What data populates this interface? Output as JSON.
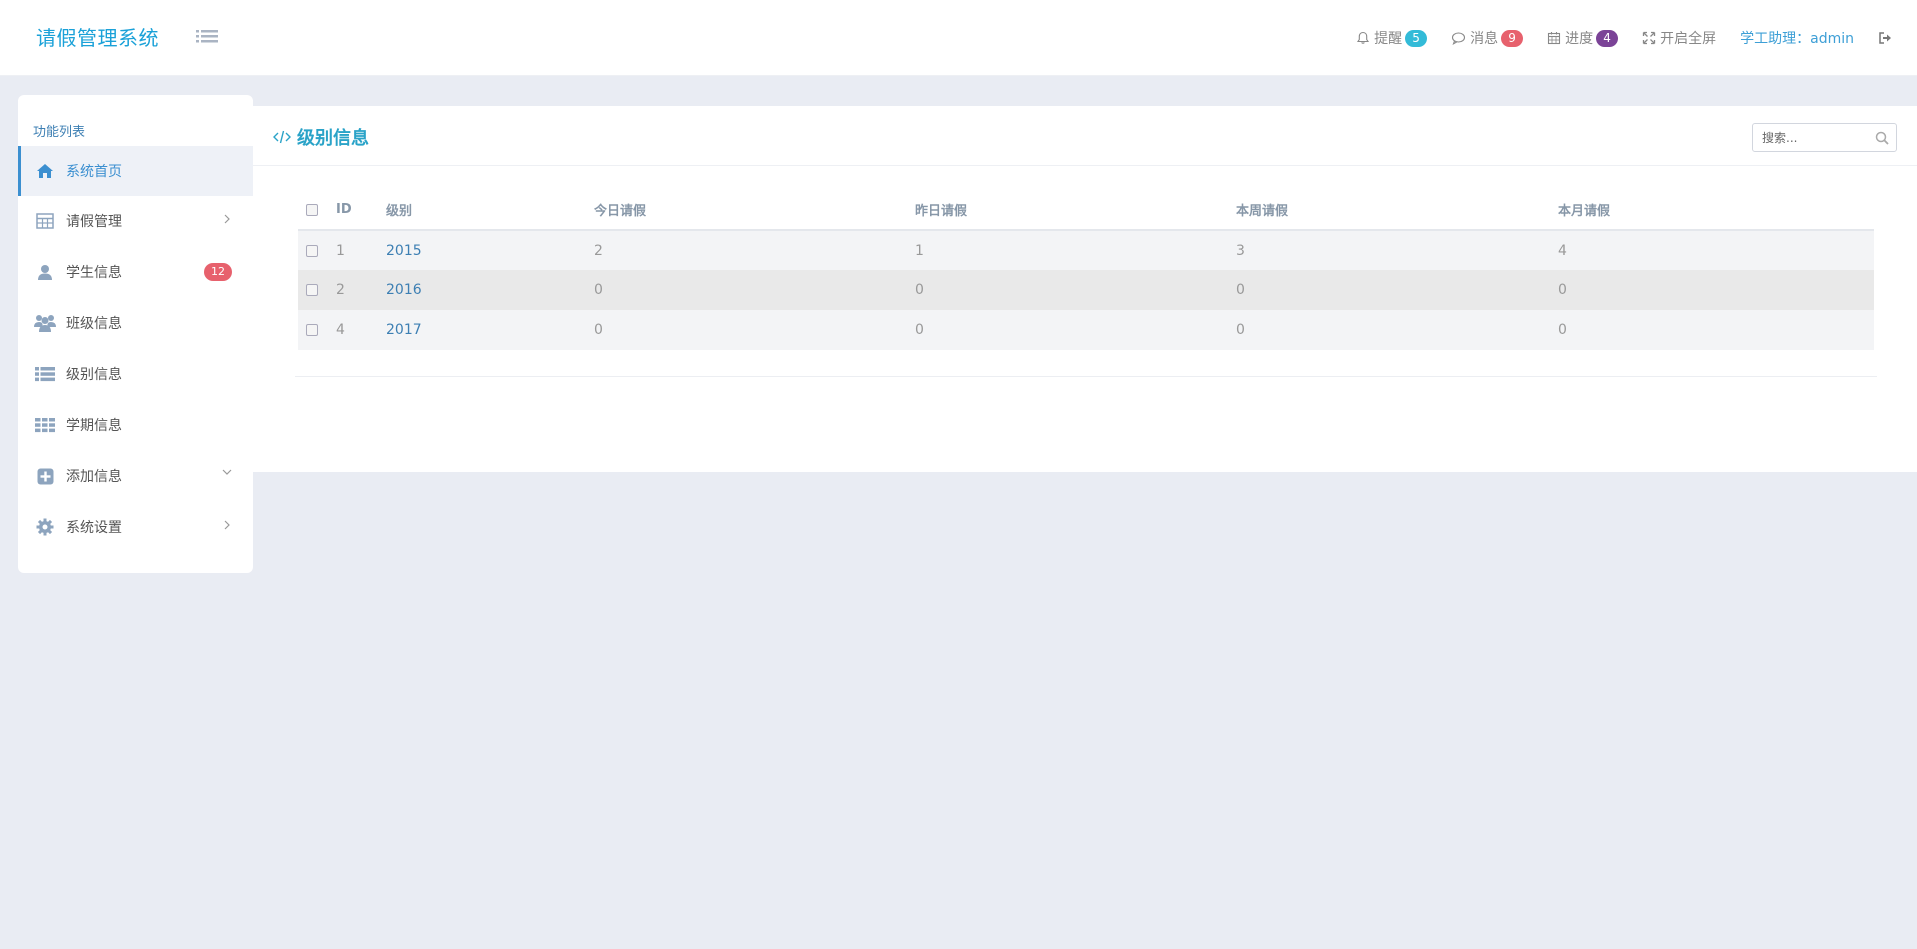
{
  "header": {
    "brand": "请假管理系统",
    "nav": {
      "remind_label": "提醒",
      "remind_count": "5",
      "message_label": "消息",
      "message_count": "9",
      "progress_label": "进度",
      "progress_count": "4",
      "fullscreen_label": "开启全屏",
      "user_label": "学工助理：admin"
    },
    "colors": {
      "remind_badge": "#33bbd8",
      "message_badge": "#e7616d",
      "progress_badge": "#7b4397"
    }
  },
  "sidebar": {
    "title": "功能列表",
    "items": [
      {
        "label": "系统首页",
        "icon": "home-icon"
      },
      {
        "label": "请假管理",
        "icon": "table-icon"
      },
      {
        "label": "学生信息",
        "icon": "user-icon",
        "badge": "12"
      },
      {
        "label": "班级信息",
        "icon": "users-icon"
      },
      {
        "label": "级别信息",
        "icon": "list-icon"
      },
      {
        "label": "学期信息",
        "icon": "grid-icon"
      },
      {
        "label": "添加信息",
        "icon": "plus-square-icon"
      },
      {
        "label": "系统设置",
        "icon": "gear-icon"
      }
    ]
  },
  "panel": {
    "title": "级别信息",
    "search_placeholder": "搜索..."
  },
  "table": {
    "columns": [
      "ID",
      "级别",
      "今日请假",
      "昨日请假",
      "本周请假",
      "本月请假"
    ],
    "rows": [
      {
        "id": "1",
        "level": "2015",
        "today": "2",
        "yesterday": "1",
        "week": "3",
        "month": "4"
      },
      {
        "id": "2",
        "level": "2016",
        "today": "0",
        "yesterday": "0",
        "week": "0",
        "month": "0"
      },
      {
        "id": "4",
        "level": "2017",
        "today": "0",
        "yesterday": "0",
        "week": "0",
        "month": "0"
      }
    ]
  }
}
